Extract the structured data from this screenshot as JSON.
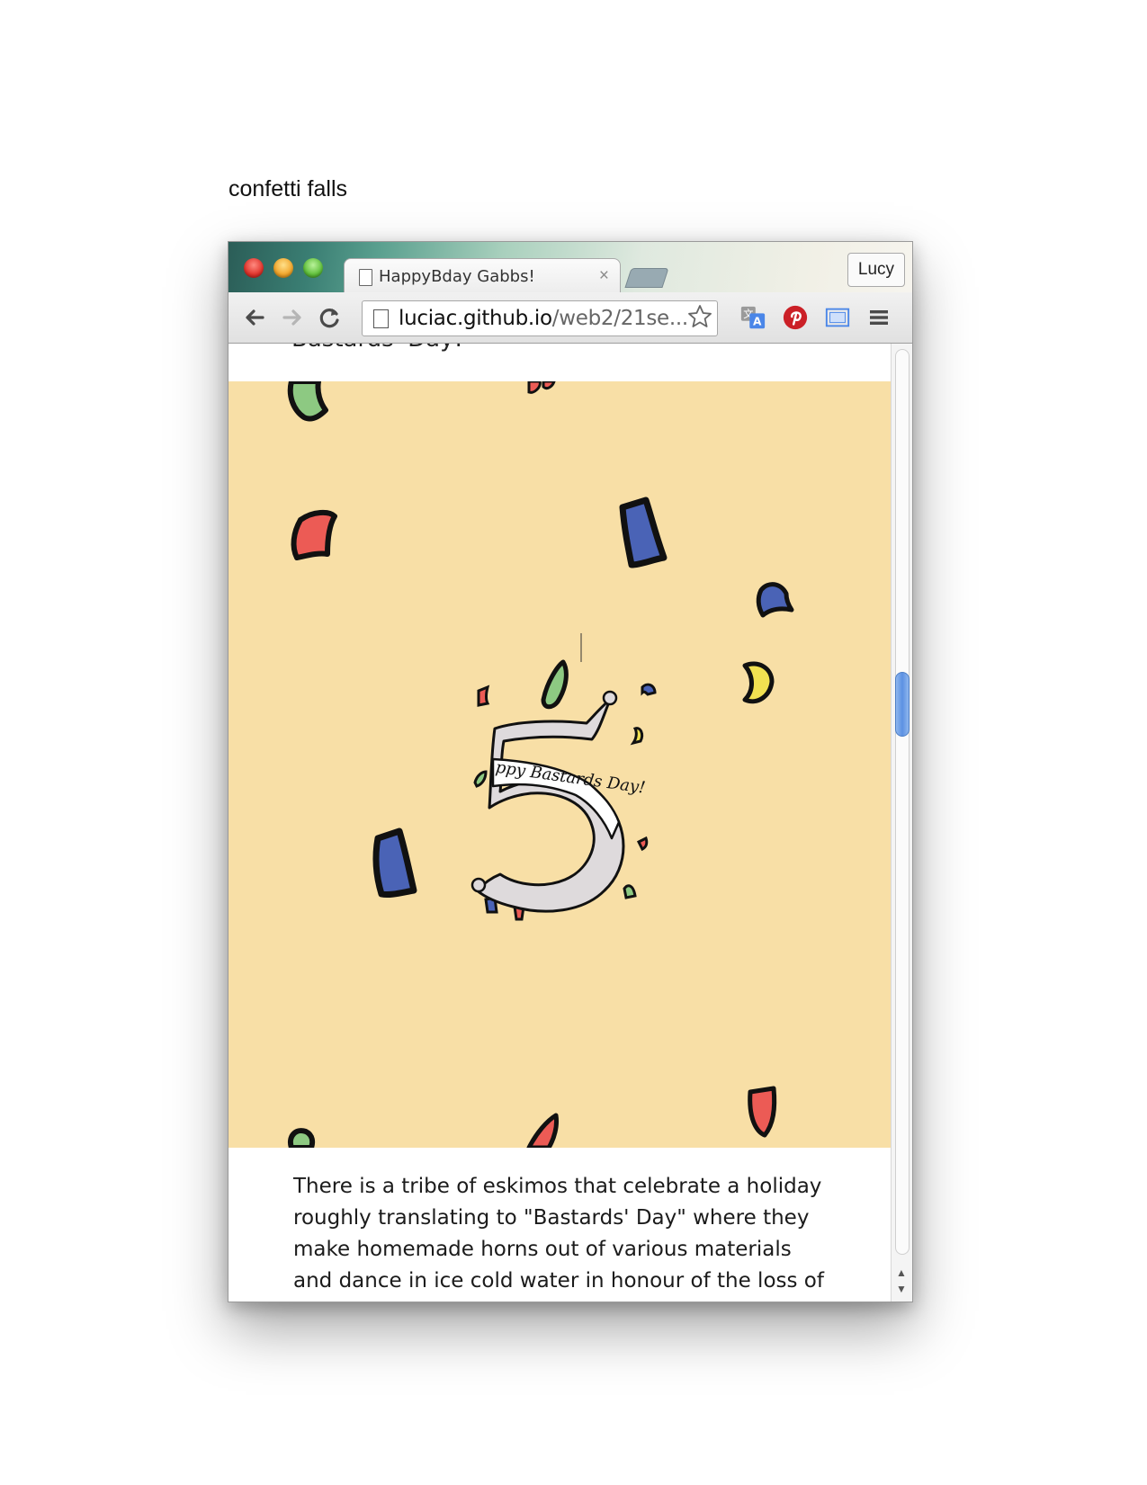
{
  "caption": "confetti falls",
  "browser": {
    "tab_title": "HappyBday Gabbs!",
    "tab_close": "×",
    "profile_name": "Lucy",
    "url_host": "luciac.github.io",
    "url_path": "/web2/21se..."
  },
  "page": {
    "cut_off_heading": "Bastards' Day!",
    "paragraph": "There is a tribe of eskimos that celebrate a holiday roughly translating to \"Bastards' Day\" where they make homemade horns out of various materials and dance in ice cold water in honour of the loss of",
    "ribbon_text": "ppy Bastards Day!",
    "big_number": "5"
  },
  "colors": {
    "stage_bg": "#f8dfa6",
    "confetti_green": "#8dc982",
    "confetti_red": "#ec5b55",
    "confetti_blue": "#4a63b6",
    "confetti_yellow": "#f1e151",
    "ribbon_fill": "#dedadc"
  },
  "icons": [
    "back-arrow-icon",
    "forward-arrow-icon",
    "reload-icon",
    "page-icon",
    "bookmark-star-icon",
    "translate-icon",
    "pinterest-icon",
    "cast-icon",
    "menu-icon"
  ]
}
